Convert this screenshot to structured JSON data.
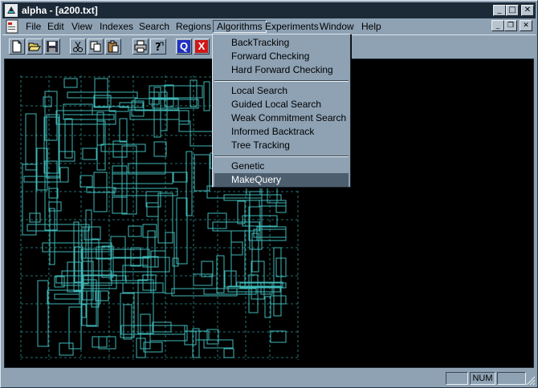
{
  "window": {
    "title": "alpha - [a200.txt]"
  },
  "menubar": {
    "items": [
      "File",
      "Edit",
      "View",
      "Indexes",
      "Search",
      "Regions",
      "Algorithms",
      "Experiments",
      "Window",
      "Help"
    ],
    "active": "Algorithms"
  },
  "toolbar": {
    "buttons": [
      "new-icon",
      "open-icon",
      "save-icon",
      "cut-icon",
      "copy-icon",
      "paste-icon",
      "print-icon",
      "help-icon",
      "query-icon",
      "close-query-icon"
    ],
    "query_label": "Q",
    "x_label": "X"
  },
  "algorithms_menu": {
    "groups": [
      [
        "BackTracking",
        "Forward Checking",
        "Hard Forward Checking"
      ],
      [
        "Local Search",
        "Guided Local Search",
        "Weak Commitment Search",
        "Informed Backtrack",
        "Tree Tracking"
      ],
      [
        "Genetic",
        "MakeQuery"
      ]
    ],
    "highlighted": "MakeQuery"
  },
  "statusbar": {
    "panels": [
      "",
      "NUM",
      ""
    ]
  },
  "colors": {
    "desktop": "#8ea2b4",
    "title": "#1c2a38",
    "canvas": "#000000",
    "trace": "#3fb8b8",
    "highlight": "#4c5e6e"
  }
}
